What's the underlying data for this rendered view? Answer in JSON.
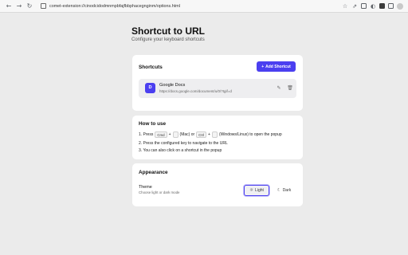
{
  "browser": {
    "url": "comet-extension://cinodcidodmnmpbfajfbbphacegnginm/options.html",
    "back_icon": "←",
    "forward_icon": "→",
    "reload_icon": "↻",
    "mic_icon": "🎙"
  },
  "page": {
    "title": "Shortcut to URL",
    "subtitle": "Configure your keyboard shortcuts"
  },
  "shortcuts": {
    "title": "Shortcuts",
    "add_label": "Add Shortcut",
    "add_icon": "+",
    "items": [
      {
        "badge": "D",
        "name": "Google Docs",
        "url": "https://docs.google.com/document/u/0/?tgif=d"
      }
    ],
    "edit_icon": "✎",
    "delete_icon": "🗑"
  },
  "howto": {
    "title": "How to use",
    "step1": {
      "prefix": "1. Press",
      "key_cmd": "Cmd",
      "plus": "+",
      "mac": "(Mac) or",
      "key_ctrl": "Ctrl",
      "suffix": "(Windows/Linux) to open the popup"
    },
    "step2": "2. Press the configured key to navigate to the URL",
    "step3": "3. You can also click on a shortcut in the popup"
  },
  "appearance": {
    "title": "Appearance",
    "theme_label": "Theme",
    "theme_desc": "Choose light or dark mode",
    "light_label": "Light",
    "dark_label": "Dark",
    "light_icon": "☼",
    "dark_icon": "☾",
    "selected": "Light"
  },
  "colors": {
    "accent": "#4b3ff0",
    "background": "#ebebeb",
    "card": "#ffffff"
  }
}
